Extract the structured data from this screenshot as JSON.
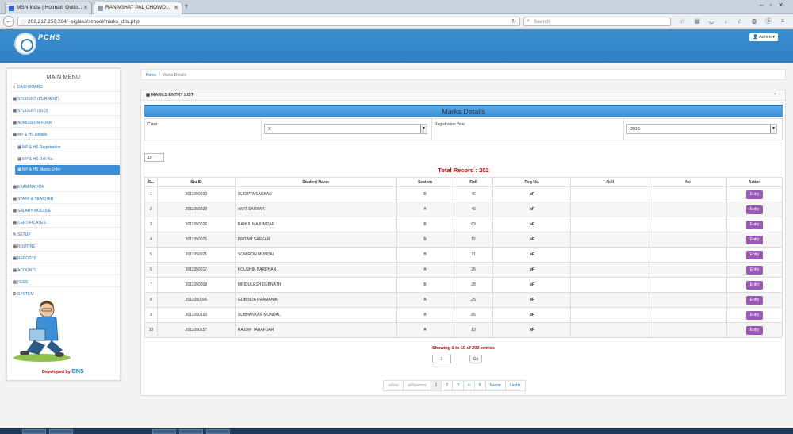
{
  "browser": {
    "tabs": [
      {
        "title": "MSN India | Hotmail, Outlo...",
        "active": false
      },
      {
        "title": "RANAGHAT PAL CHOWD...",
        "active": true
      }
    ],
    "url": "209.217.250.204/~siglass/school/marks_dtls.php",
    "search_placeholder": "Search"
  },
  "header": {
    "logo_text": "PCHS",
    "admin_label": "Admin ▾"
  },
  "sidebar": {
    "title": "MAIN MENU",
    "items": [
      {
        "label": "DASHBOARD",
        "icon": "home-icon"
      },
      {
        "label": "STUDENT (CURRENT)",
        "icon": "grid-icon"
      },
      {
        "label": "STUDENT (OLD)",
        "icon": "grid-icon"
      },
      {
        "label": "ADMISSION FORM",
        "icon": "grid-icon"
      },
      {
        "label": "MP & HS Details",
        "icon": "grid-icon"
      },
      {
        "label": "MP & HS Registration",
        "icon": "grid-icon",
        "sub": true
      },
      {
        "label": "MP & HS Roll No.",
        "icon": "grid-icon",
        "sub": true
      },
      {
        "label": "MP & HS Marks Entry",
        "icon": "grid-icon",
        "sub": true,
        "active": true
      },
      {
        "label": "EXAMINATION",
        "icon": "grid-icon"
      },
      {
        "label": "STAFF & TEACHER",
        "icon": "grid-icon"
      },
      {
        "label": "SALARY MODULE",
        "icon": "grid-icon"
      },
      {
        "label": "CERTIFICATES",
        "icon": "grid-icon"
      },
      {
        "label": "SETUP",
        "icon": "wrench-icon"
      },
      {
        "label": "ROUTINE",
        "icon": "grid-icon"
      },
      {
        "label": "REPORTS",
        "icon": "grid-icon"
      },
      {
        "label": "ACOUNTS",
        "icon": "grid-icon"
      },
      {
        "label": "FEES",
        "icon": "grid-icon"
      },
      {
        "label": "SYSTEM",
        "icon": "cogs-icon"
      }
    ],
    "developed_by": "Developed by",
    "developer_brand": "ƱNS"
  },
  "breadcrumb": {
    "home": "Home",
    "separator": "/",
    "current": "Marks Details"
  },
  "panel": {
    "title": "MARKS ENTRY LIST",
    "marks_title": "Marks Details",
    "class_label": "Class",
    "class_value": "X",
    "reg_year_label": "Registration Year",
    "reg_year_value": "2016",
    "page_size": "10",
    "total_record": "Total Record : 202"
  },
  "table": {
    "headers": [
      "SL.",
      "Stu ID",
      "Student Name",
      "Section",
      "Roll",
      "Reg No.",
      "Roll",
      "No",
      "Action"
    ],
    "rows": [
      [
        "1",
        "2011050030",
        "SUDIPTA SARKAR",
        "B",
        "46",
        "oF",
        "",
        "",
        "Entry"
      ],
      [
        "2",
        "2011050029",
        "AMIT SARKAR",
        "A",
        "46",
        "oF",
        "",
        "",
        "Entry"
      ],
      [
        "3",
        "2011050026",
        "RAHUL MAJUMDAR",
        "B",
        "63",
        "oF",
        "",
        "",
        "Entry"
      ],
      [
        "4",
        "2011050025",
        "PRITAM SARKAR",
        "B",
        "12",
        "oF",
        "",
        "",
        "Entry"
      ],
      [
        "5",
        "2011050021",
        "SOMIRON MONDAL",
        "B",
        "71",
        "oF",
        "",
        "",
        "Entry"
      ],
      [
        "6",
        "2011050017",
        "KOUSHIK BARDHAN",
        "A",
        "26",
        "oF",
        "",
        "",
        "Entry"
      ],
      [
        "7",
        "2011050009",
        "MRIDULESH DEBNATH",
        "B",
        "28",
        "oF",
        "",
        "",
        "Entry"
      ],
      [
        "8",
        "2011050006",
        "GOBINDA PRAMANIK",
        "A",
        "25",
        "oF",
        "",
        "",
        "Entry"
      ],
      [
        "9",
        "2011050163",
        "SUBHANKAR MONDAL",
        "A",
        "85",
        "oF",
        "",
        "",
        "Entry"
      ],
      [
        "10",
        "2011050157",
        "RAJDIP TARAFDAR",
        "A",
        "13",
        "oF",
        "",
        "",
        "Entry"
      ]
    ]
  },
  "pagination": {
    "showing": "Showing 1 to 10 of 202 entries",
    "goto_value": "1",
    "go_label": "Go",
    "first": "First",
    "previous": "Previous",
    "pages": [
      "1",
      "2",
      "3",
      "4",
      "5"
    ],
    "next": "Next",
    "last": "Last"
  }
}
